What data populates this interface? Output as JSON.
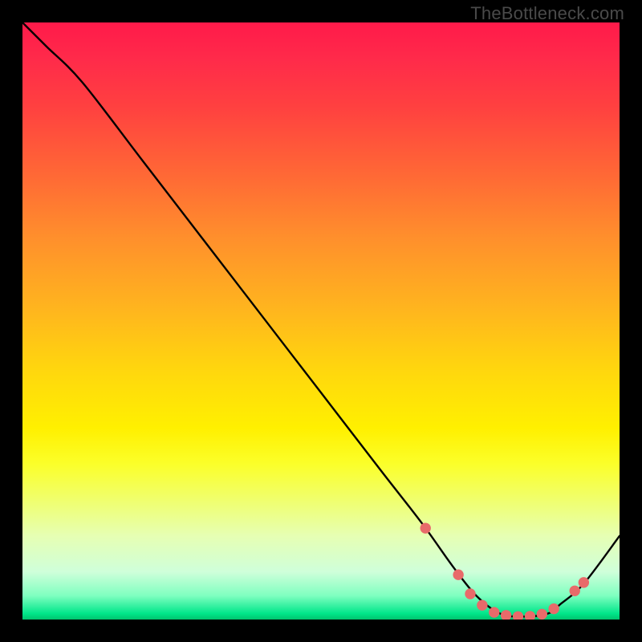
{
  "watermark": "TheBottleneck.com",
  "chart_data": {
    "type": "line",
    "title": "",
    "xlabel": "",
    "ylabel": "",
    "xlim": [
      0,
      100
    ],
    "ylim": [
      0,
      100
    ],
    "grid": false,
    "series": [
      {
        "name": "curve",
        "color": "#000000",
        "x": [
          0,
          4,
          10,
          20,
          30,
          40,
          50,
          60,
          67,
          72,
          76,
          80,
          84,
          88,
          90,
          94,
          100
        ],
        "y": [
          100,
          96,
          90,
          77,
          64,
          51,
          38,
          25,
          16,
          9,
          4,
          1,
          0.5,
          1,
          2.5,
          6,
          14
        ]
      }
    ],
    "markers": {
      "name": "dots",
      "color": "#e86a6a",
      "radius_norm": 0.9,
      "x": [
        67.5,
        73,
        75,
        77,
        79,
        81,
        83,
        85,
        87,
        89,
        92.5,
        94
      ],
      "y": [
        15.3,
        7.5,
        4.3,
        2.4,
        1.2,
        0.7,
        0.5,
        0.55,
        0.9,
        1.8,
        4.8,
        6.2
      ]
    }
  }
}
